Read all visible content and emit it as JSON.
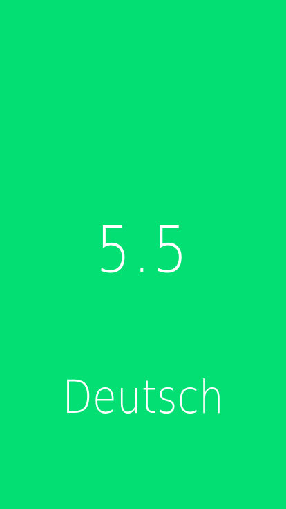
{
  "card": {
    "grade": "5.5",
    "subject": "Deutsch",
    "background_color": "#04DF73",
    "text_color": "#FFFFFF"
  }
}
